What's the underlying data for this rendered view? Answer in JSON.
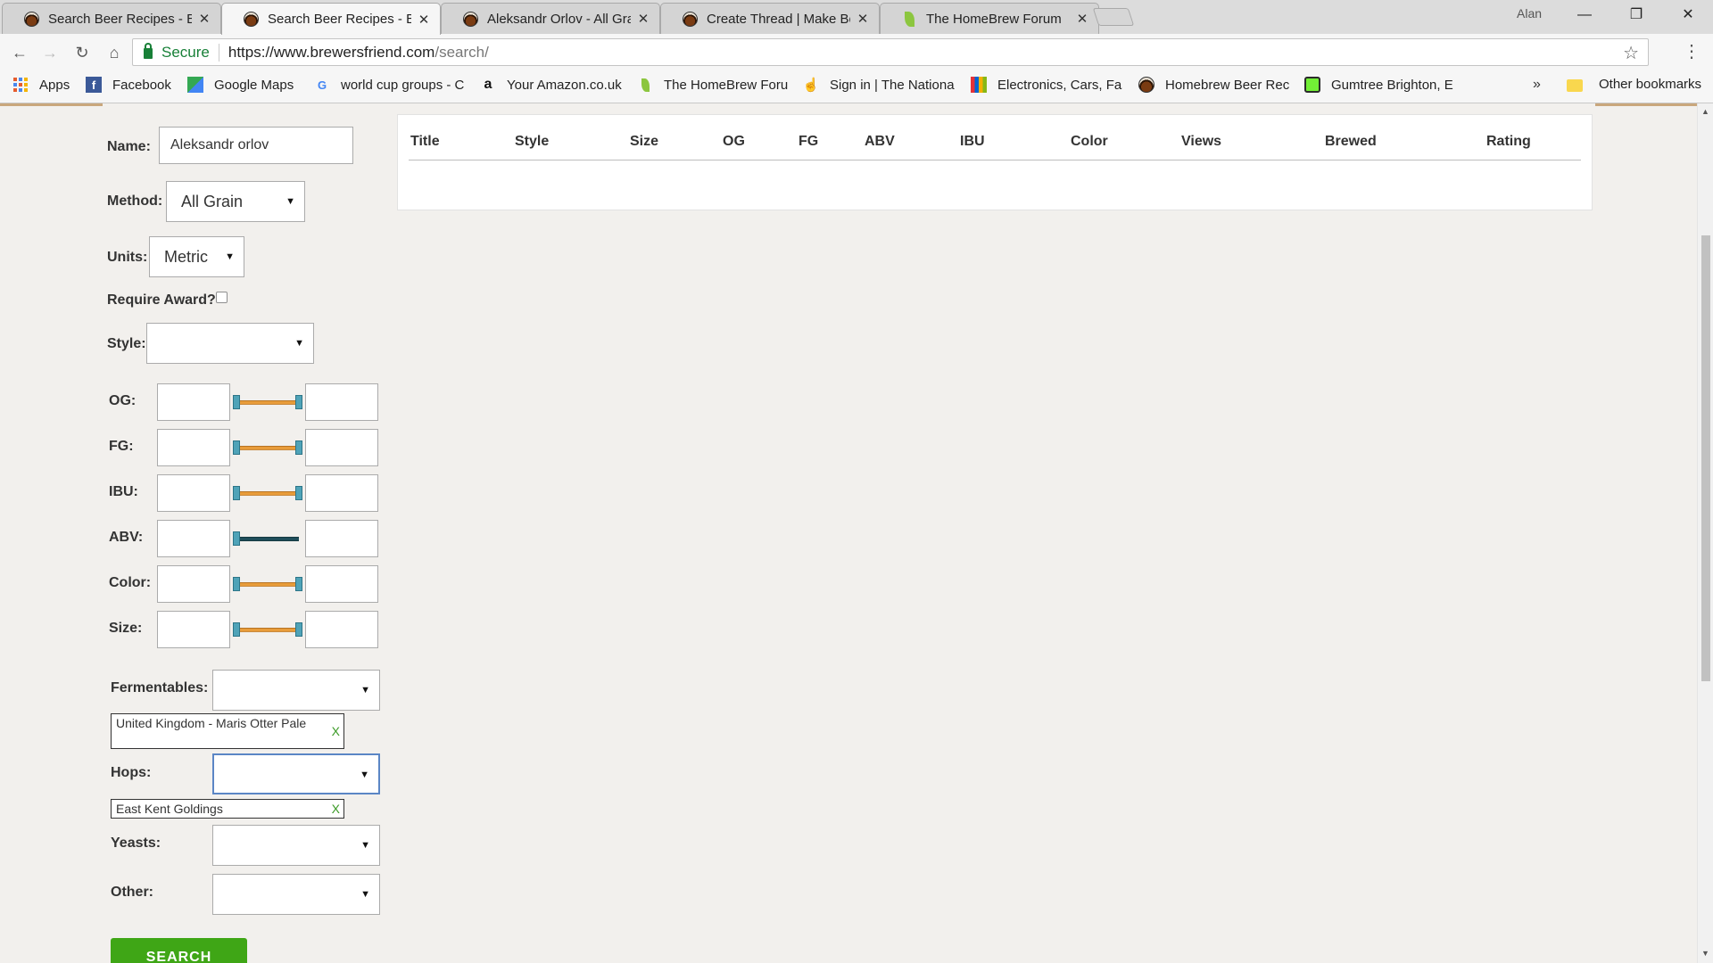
{
  "browser": {
    "tabs": [
      {
        "title": "Search Beer Recipes - Bre"
      },
      {
        "title": "Search Beer Recipes - Bre"
      },
      {
        "title": "Aleksandr Orlov - All Grai"
      },
      {
        "title": "Create Thread | Make Bee"
      },
      {
        "title": "The HomeBrew Forum"
      }
    ],
    "tab_close_glyph": "✕",
    "profile_name": "Alan",
    "window": {
      "minimize": "—",
      "maximize": "❐",
      "close": "✕"
    },
    "nav": {
      "back": "←",
      "forward": "→",
      "reload": "↻",
      "home": "⌂"
    },
    "omnibox": {
      "secure_label": "Secure",
      "url_host": "https://www.brewersfriend.com",
      "url_path": "/search/"
    },
    "star_glyph": "☆",
    "menu_glyph": "⋮",
    "bookmarks": [
      {
        "label": "Apps",
        "icon": "apps-icon"
      },
      {
        "label": "Facebook",
        "icon": "facebook-icon"
      },
      {
        "label": "Google Maps",
        "icon": "google-maps-icon"
      },
      {
        "label": "world cup groups - C",
        "icon": "google-icon"
      },
      {
        "label": "Your Amazon.co.uk",
        "icon": "amazon-icon"
      },
      {
        "label": "The HomeBrew Foru",
        "icon": "leaf-icon"
      },
      {
        "label": "Sign in | The Nationa",
        "icon": "hand-icon"
      },
      {
        "label": "Electronics, Cars, Fas",
        "icon": "ebay-icon"
      },
      {
        "label": "Homebrew Beer Rec",
        "icon": "beer-icon"
      },
      {
        "label": "Gumtree Brighton, E",
        "icon": "gumtree-icon"
      }
    ],
    "bookmarks_overflow": "»",
    "other_bookmarks": "Other bookmarks"
  },
  "search_form": {
    "name_label": "Name:",
    "name_value": "Aleksandr orlov",
    "method_label": "Method:",
    "method_value": "All Grain",
    "units_label": "Units:",
    "units_value": "Metric",
    "require_award_label": "Require Award?",
    "require_award_checked": false,
    "style_label": "Style:",
    "style_value": "",
    "caret": "▼",
    "ranges": [
      {
        "label": "OG:",
        "min": "",
        "max": ""
      },
      {
        "label": "FG:",
        "min": "",
        "max": ""
      },
      {
        "label": "IBU:",
        "min": "",
        "max": ""
      },
      {
        "label": "ABV:",
        "min": "",
        "max": ""
      },
      {
        "label": "Color:",
        "min": "",
        "max": ""
      },
      {
        "label": "Size:",
        "min": "",
        "max": ""
      }
    ],
    "fermentables_label": "Fermentables:",
    "fermentables_selected": "United Kingdom - Maris Otter Pale",
    "hops_label": "Hops:",
    "hops_selected": "East Kent Goldings",
    "yeasts_label": "Yeasts:",
    "other_label": "Other:",
    "remove_glyph": "X",
    "search_button": "SEARCH"
  },
  "results_table": {
    "columns": [
      "Title",
      "Style",
      "Size",
      "OG",
      "FG",
      "ABV",
      "IBU",
      "Color",
      "Views",
      "Brewed",
      "Rating"
    ],
    "rows": []
  },
  "colors": {
    "accent_green": "#3fa616",
    "slider_orange": "#e89c3a",
    "slider_handle": "#4fa3b8",
    "slider_dark": "#1f4e5a",
    "secure_green": "#188038"
  }
}
